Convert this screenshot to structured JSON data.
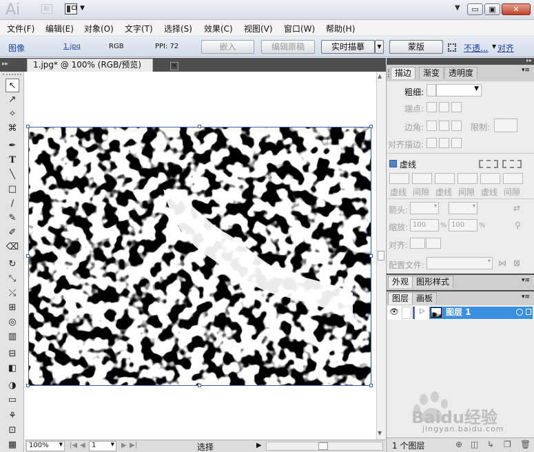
{
  "app": {
    "logo": "Ai",
    "bridge": "Br",
    "minimize": "▭",
    "restore": "▣",
    "close": "✕"
  },
  "menu": [
    "文件(F)",
    "编辑(E)",
    "对象(O)",
    "文字(T)",
    "选择(S)",
    "效果(C)",
    "视图(V)",
    "窗口(W)",
    "帮助(H)"
  ],
  "control": {
    "object_type": "图像",
    "file": "1.jpg",
    "mode": "RGB",
    "ppi": "PPI: 72",
    "embed": "嵌入",
    "edit_original": "编辑原稿",
    "live_trace": "实时描摹",
    "mask": "蒙版",
    "opacity": "不透...",
    "align": "对齐"
  },
  "document": {
    "tab": "1.jpg* @ 100% (RGB/预览)",
    "close": "✕"
  },
  "tools": [
    "↖",
    "↗",
    "✧",
    "⌘",
    "✒",
    "T",
    "╲",
    "□",
    "∕",
    "✎",
    "✐",
    "⌫",
    "↻",
    "⤡",
    "⤯",
    "⊞",
    "◎",
    "▥",
    "⊟",
    "◧",
    "◑",
    "▭",
    "⚘",
    "⊡",
    "▦",
    "✋"
  ],
  "status": {
    "zoom": "100%",
    "page": "1",
    "mode": "选择"
  },
  "stroke_panel": {
    "tabs": [
      "描边",
      "渐变",
      "透明度"
    ],
    "weight_label": "粗细:",
    "cap_label": "端点:",
    "corner_label": "边角:",
    "limit_label": "限制:",
    "align_label": "对齐描边:",
    "dashed_label": "虚线",
    "dash_labels": [
      "虚线",
      "间隙",
      "虚线",
      "间隙",
      "虚线",
      "间隙"
    ],
    "arrow_label": "箭头:",
    "scale_label": "缩放:",
    "scale_values": [
      "100",
      "100"
    ],
    "align2_label": "对齐:",
    "profile_label": "配置文件:"
  },
  "appearance_tabs": [
    "外观",
    "图形样式"
  ],
  "layers_panel": {
    "tabs": [
      "图层",
      "画板"
    ],
    "layer_name": "图层 1",
    "footer": "1 个图层"
  },
  "watermark": {
    "brand": "Baidu经验",
    "url": "jingyan.baidu.com"
  }
}
